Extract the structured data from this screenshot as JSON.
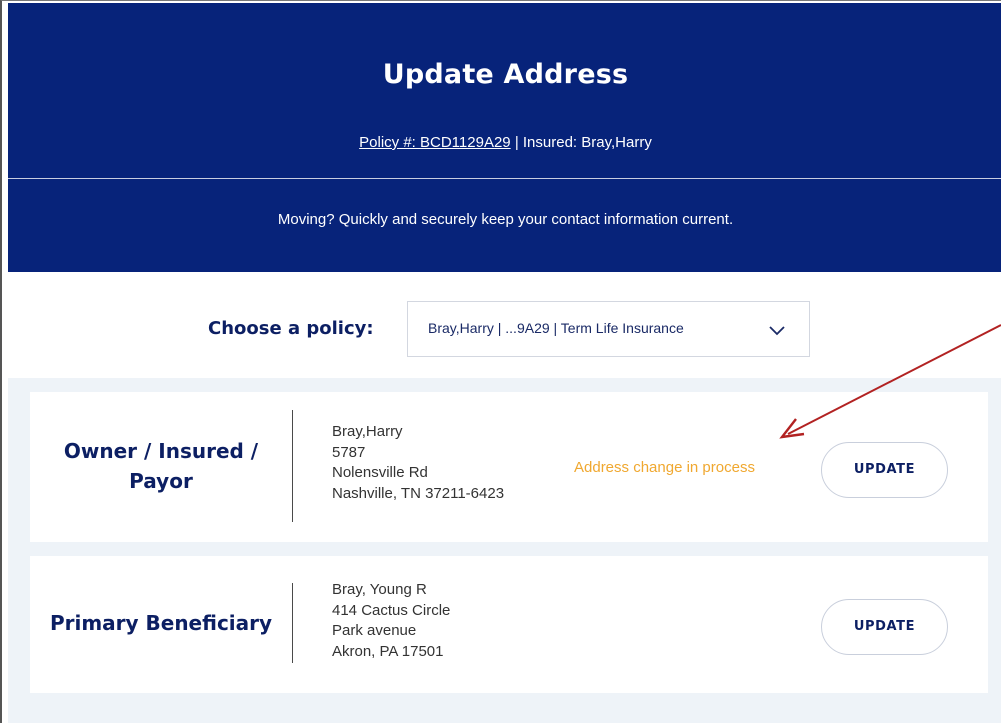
{
  "header": {
    "title": "Update Address",
    "policy_link": "Policy #: BCD1129A29",
    "separator": "|",
    "insured": "Insured: Bray,Harry",
    "subtitle": "Moving? Quickly and securely keep your contact information current."
  },
  "policy_chooser": {
    "label": "Choose a policy:",
    "selected": "Bray,Harry | ...9A29 | Term Life Insurance",
    "chevron_icon": "chevron-down-icon"
  },
  "cards": [
    {
      "role_line1": "Owner / Insured /",
      "role_line2": "Payor",
      "address_lines": [
        "Bray,Harry",
        "5787",
        "Nolensville Rd",
        "Nashville, TN 37211-6423"
      ],
      "status": "Address change in process",
      "button": "UPDATE"
    },
    {
      "role_line1": "Primary Beneficiary",
      "address_lines": [
        "Bray, Young R",
        "414 Cactus Circle",
        "Park avenue",
        "Akron, PA 17501"
      ],
      "button": "UPDATE"
    }
  ],
  "colors": {
    "header_bg": "#07237a",
    "heading_text": "#0c1f63",
    "status_text": "#f0a830",
    "annotation_arrow": "#b22222",
    "list_bg": "#eef3f8"
  }
}
